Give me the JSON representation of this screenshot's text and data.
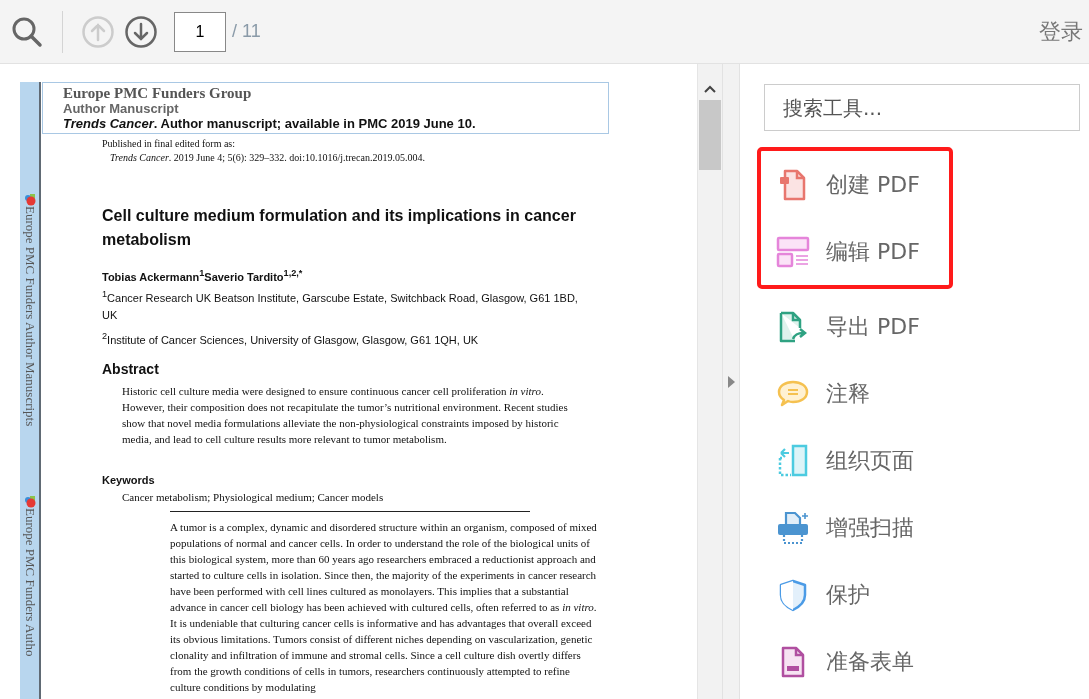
{
  "toolbar": {
    "page_input": {
      "value": "1"
    },
    "page_total": "/ 11",
    "prev_page": {
      "disabled": true
    },
    "next_page": {
      "disabled": false
    },
    "sign_in": "登录"
  },
  "document": {
    "side_strip": [
      "Europe PMC Funders Author Manuscripts",
      "Europe PMC Funders Autho"
    ],
    "header": {
      "group": "Europe PMC Funders Group",
      "type": "Author Manuscript",
      "citation": "*Trends Cancer*. Author manuscript; available in PMC 2019 June 10."
    },
    "published_label": "Published in final edited form as:",
    "published_ref": "*Trends Cancer*. 2019 June 4; 5(6): 329–332. doi:10.1016/j.trecan.2019.05.004.",
    "title": "Cell culture medium formulation and its implications in cancer metabolism",
    "authors": "Tobias Ackermann$^{1}$Saverio Tardito$^{1,2,*}$",
    "affiliations": [
      "$^{1}$Cancer Research UK Beatson Institute, Garscube Estate, Switchback Road, Glasgow, G61 1BD, UK",
      "$^{2}$Institute of Cancer Sciences, University of Glasgow, Glasgow, G61 1QH, UK"
    ],
    "abstract_heading": "Abstract",
    "abstract": "Historic cell culture media were designed to ensure continuous cancer cell proliferation *in vitro*. However, their composition does not recapitulate the tumor’s nutritional environment. Recent studies show that novel media formulations alleviate the non-physiological constraints imposed by historic media, and lead to cell culture results more relevant to tumor metabolism.",
    "keywords_heading": "Keywords",
    "keywords": "Cancer metabolism; Physiological medium; Cancer models",
    "body": "A tumor is a complex, dynamic and disordered structure within an organism, composed of mixed populations of normal and cancer cells. In order to understand the role of the biological units of this biological system, more than 60 years ago researchers embraced a reductionist approach and started to culture cells in isolation. Since then, the majority of the experiments in cancer research have been performed with cell lines cultured as monolayers. This implies that a substantial advance in cancer cell biology has been achieved with cultured cells, often referred to as *in vitro*. It is undeniable that culturing cancer cells is informative and has advantages that overall exceed its obvious limitations. Tumors consist of different niches depending on vascularization, genetic clonality and infiltration of immune and stromal cells. Since a cell culture dish overtly differs from the growth conditions of cells in tumors, researchers continuously attempted to refine culture conditions by modulating"
  },
  "tools_panel": {
    "search": {
      "placeholder": "搜索工具..."
    },
    "groups": [
      {
        "highlighted": true,
        "tools": [
          {
            "kind": "create",
            "label": "创建 PDF"
          },
          {
            "kind": "edit",
            "label": "编辑 PDF"
          }
        ]
      },
      {
        "highlighted": false,
        "tools": [
          {
            "kind": "export",
            "label": "导出 PDF"
          },
          {
            "kind": "comment",
            "label": "注释"
          },
          {
            "kind": "organize",
            "label": "组织页面"
          },
          {
            "kind": "scan",
            "label": "增强扫描"
          },
          {
            "kind": "protect",
            "label": "保护"
          },
          {
            "kind": "form",
            "label": "准备表单"
          }
        ]
      }
    ]
  }
}
